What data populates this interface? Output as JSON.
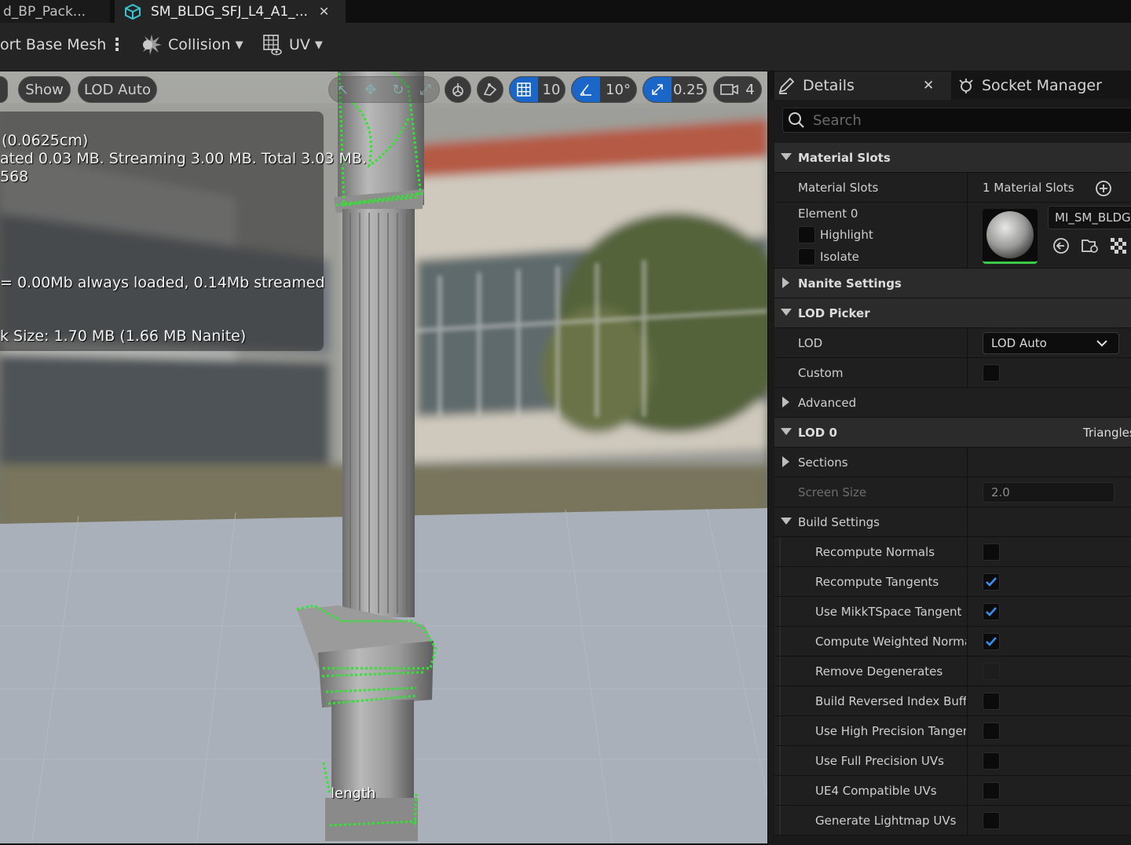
{
  "tabs": [
    {
      "label": "d_BP_Pack..."
    },
    {
      "label": "SM_BLDG_SFJ_L4_A1_..."
    }
  ],
  "toolbar": {
    "import_label": "ort Base Mesh",
    "collision_label": "Collision",
    "uv_label": "UV"
  },
  "viewport": {
    "show_label": "Show",
    "lod_label": "LOD Auto",
    "grid_snap": "10",
    "rotation_snap": "10°",
    "scale_snap": "0.25",
    "camera_speed": "4",
    "stats": [
      "(0.0625cm)",
      "ated 0.03 MB. Streaming 3.00 MB. Total 3.03 MB.",
      "568",
      "= 0.00Mb always loaded, 0.14Mb streamed",
      "k Size: 1.70 MB (1.66 MB Nanite)"
    ],
    "overlay_label": "length"
  },
  "panel": {
    "details_tab": "Details",
    "socket_tab": "Socket Manager",
    "search_placeholder": "Search",
    "material_slots_header": "Material Slots",
    "material_slots_label": "Material Slots",
    "material_slots_count": "1 Material Slots",
    "element_label": "Element 0",
    "highlight_label": "Highlight",
    "isolate_label": "Isolate",
    "material_name": "MI_SM_BLDG_",
    "nanite_header": "Nanite Settings",
    "lod_picker_header": "LOD Picker",
    "lod_label": "LOD",
    "lod_value": "LOD Auto",
    "custom_label": "Custom",
    "advanced_label": "Advanced",
    "lod0_header": "LOD 0",
    "triangles_label": "Triangles",
    "sections_label": "Sections",
    "screen_size_label": "Screen Size",
    "screen_size_value": "2.0",
    "build_settings_label": "Build Settings",
    "build_settings": [
      {
        "label": "Recompute Normals",
        "checked": false
      },
      {
        "label": "Recompute Tangents",
        "checked": true
      },
      {
        "label": "Use MikkTSpace Tangent Sp",
        "checked": true
      },
      {
        "label": "Compute Weighted Normals",
        "checked": true
      },
      {
        "label": "Remove Degenerates",
        "checked": false
      },
      {
        "label": "Build Reversed Index Buffer",
        "checked": false
      },
      {
        "label": "Use High Precision Tangent B",
        "checked": false
      },
      {
        "label": "Use Full Precision UVs",
        "checked": false
      },
      {
        "label": "UE4 Compatible UVs",
        "checked": false
      },
      {
        "label": "Generate Lightmap UVs",
        "checked": false
      }
    ]
  },
  "colors": {
    "accent": "#1a66c9",
    "check": "#3a8ff0",
    "wire": "#2be82b"
  }
}
